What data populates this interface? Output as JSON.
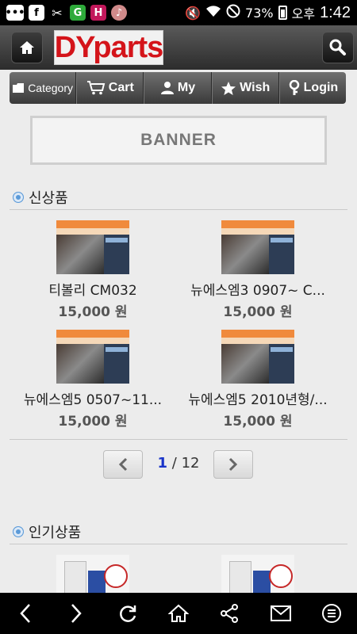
{
  "status": {
    "battery": "73%",
    "ampm": "오후",
    "time": "1:42",
    "app_icon_g": "G",
    "app_icon_h": "H",
    "app_icon_f": "f"
  },
  "header": {
    "logo_text": "DYparts",
    "home_icon": "home-icon",
    "search_icon": "search-icon"
  },
  "nav": {
    "items": [
      {
        "label": "Category",
        "icon": "folder-icon"
      },
      {
        "label": "Cart",
        "icon": "cart-icon"
      },
      {
        "label": "My",
        "icon": "user-icon"
      },
      {
        "label": "Wish",
        "icon": "star-icon"
      },
      {
        "label": "Login",
        "icon": "key-icon"
      }
    ]
  },
  "banner": {
    "label": "BANNER"
  },
  "sections": {
    "new": {
      "title": "신상품"
    },
    "popular": {
      "title": "인기상품"
    }
  },
  "products": [
    {
      "name": "티볼리 CM032",
      "price": "15,000 원"
    },
    {
      "name": "뉴에스엠3 0907~ C...",
      "price": "15,000 원"
    },
    {
      "name": "뉴에스엠5 0507~11...",
      "price": "15,000 원"
    },
    {
      "name": "뉴에스엠5 2010년형/...",
      "price": "15,000 원"
    }
  ],
  "pager": {
    "current": "1",
    "separator": " / ",
    "total": "12"
  },
  "colors": {
    "accent": "#d4141a",
    "page_current": "#1a35c9",
    "section_dot": "#5b9ad8"
  }
}
